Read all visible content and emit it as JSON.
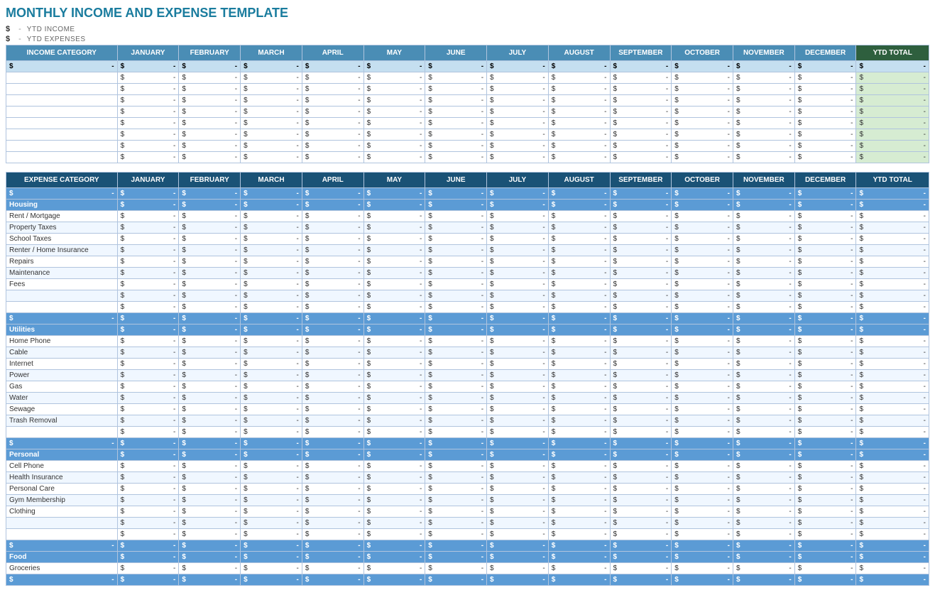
{
  "title": "MONTHLY INCOME AND EXPENSE TEMPLATE",
  "ytd": {
    "income_label": "YTD INCOME",
    "expense_label": "YTD EXPENSES",
    "dollar": "$",
    "dash": "-"
  },
  "months": [
    "JANUARY",
    "FEBRUARY",
    "MARCH",
    "APRIL",
    "MAY",
    "JUNE",
    "JULY",
    "AUGUST",
    "SEPTEMBER",
    "OCTOBER",
    "NOVEMBER",
    "DECEMBER"
  ],
  "ytd_total": "YTD TOTAL",
  "income_table": {
    "category_header": "INCOME CATEGORY",
    "total_row_symbol": "$",
    "data_rows": 8
  },
  "expense_table": {
    "category_header": "EXPENSE CATEGORY",
    "categories": [
      {
        "name": "Housing",
        "items": [
          "Rent / Mortgage",
          "Property Taxes",
          "School Taxes",
          "Renter / Home Insurance",
          "Repairs",
          "Maintenance",
          "Fees",
          "",
          ""
        ]
      },
      {
        "name": "Utilities",
        "items": [
          "Home Phone",
          "Cable",
          "Internet",
          "Power",
          "Gas",
          "Water",
          "Sewage",
          "Trash Removal",
          ""
        ]
      },
      {
        "name": "Personal",
        "items": [
          "Cell Phone",
          "Health Insurance",
          "Personal Care",
          "Gym Membership",
          "Clothing",
          "",
          ""
        ]
      },
      {
        "name": "Food",
        "items": [
          "Groceries"
        ]
      }
    ]
  }
}
